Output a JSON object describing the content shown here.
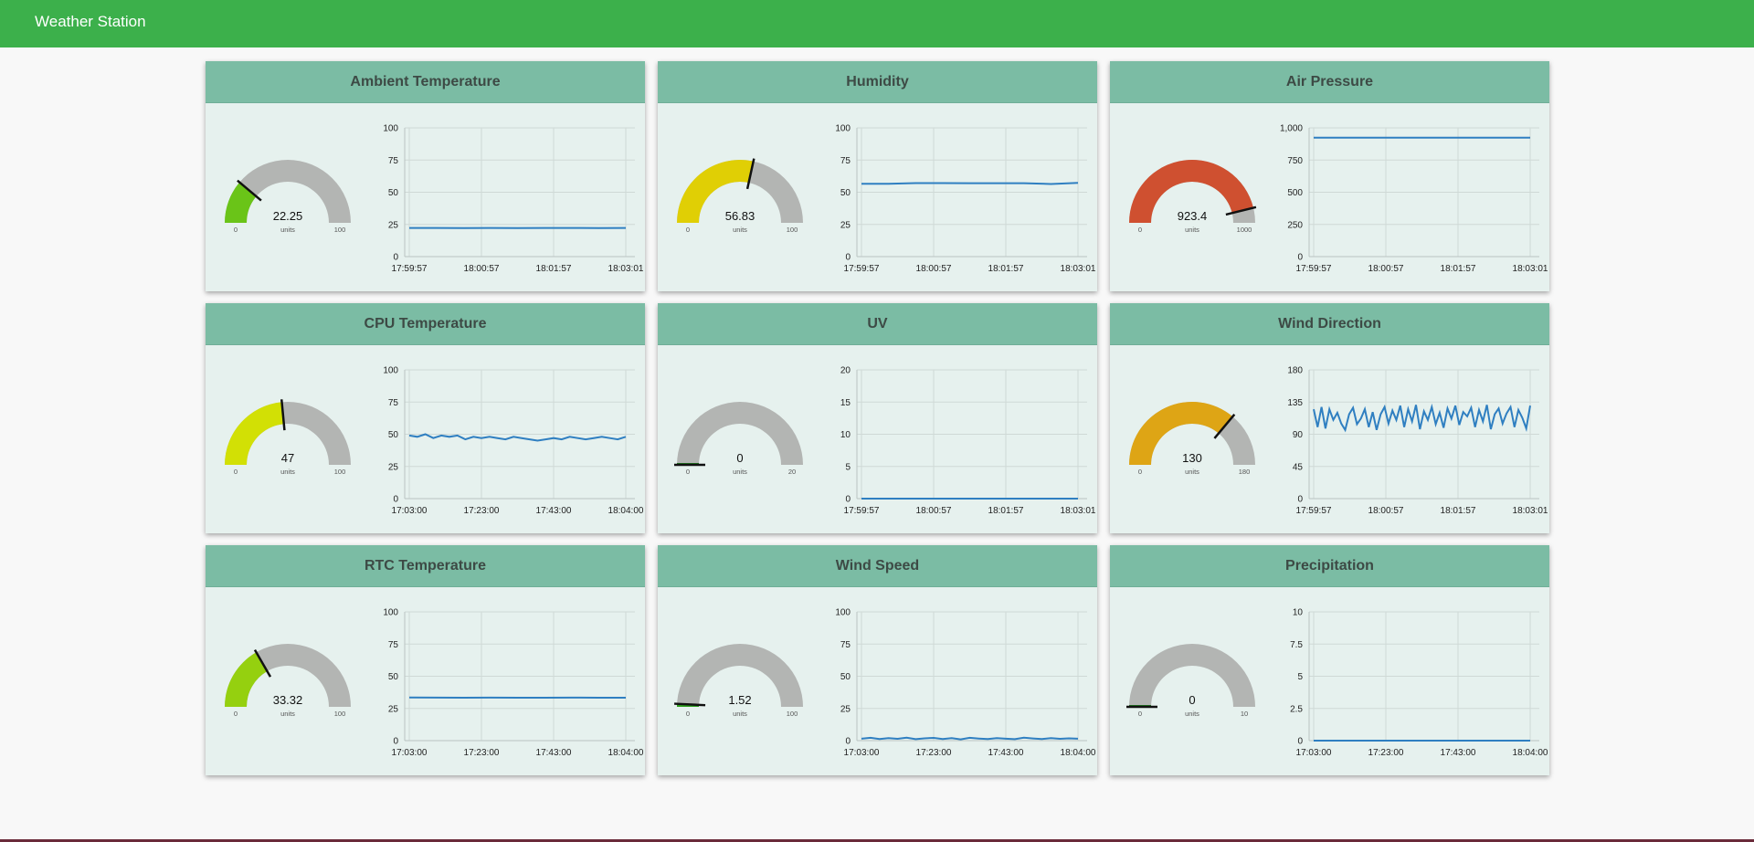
{
  "app": {
    "title": "Weather Station"
  },
  "colors": {
    "header_bar": "#3cb04b",
    "card_header": "#7bbca4",
    "card_bg": "#e6f1ee",
    "gauge_track": "#b3b5b3",
    "line": "#2f7fc1"
  },
  "cards": [
    {
      "title": "Ambient Temperature",
      "gauge": {
        "value": "22.25",
        "units": "units",
        "min": "0",
        "max": "100",
        "color": "#6ac418",
        "num": 22.25,
        "lo": 0,
        "hi": 100
      },
      "chart_data": {
        "type": "line",
        "y_ticks": [
          "100",
          "75",
          "50",
          "25",
          "0"
        ],
        "x_ticks": [
          "17:59:57",
          "18:00:57",
          "18:01:57",
          "18:03:01"
        ],
        "ylim": [
          0,
          100
        ],
        "series": [
          {
            "values": [
              22.3,
              22.3,
              22.2,
              22.3,
              22.2,
              22.3,
              22.3,
              22.2,
              22.25
            ]
          }
        ]
      }
    },
    {
      "title": "Humidity",
      "gauge": {
        "value": "56.83",
        "units": "units",
        "min": "0",
        "max": "100",
        "color": "#e0cf05",
        "num": 56.83,
        "lo": 0,
        "hi": 100
      },
      "chart_data": {
        "type": "line",
        "y_ticks": [
          "100",
          "75",
          "50",
          "25",
          "0"
        ],
        "x_ticks": [
          "17:59:57",
          "18:00:57",
          "18:01:57",
          "18:03:01"
        ],
        "ylim": [
          0,
          100
        ],
        "series": [
          {
            "values": [
              56.5,
              56.5,
              57.1,
              57.1,
              57.0,
              57.0,
              57.0,
              56.4,
              57.2
            ]
          }
        ]
      }
    },
    {
      "title": "Air Pressure",
      "gauge": {
        "value": "923.4",
        "units": "units",
        "min": "0",
        "max": "1000",
        "color": "#cf5030",
        "num": 923.4,
        "lo": 0,
        "hi": 1000
      },
      "chart_data": {
        "type": "line",
        "y_ticks": [
          "1,000",
          "750",
          "500",
          "250",
          "0"
        ],
        "x_ticks": [
          "17:59:57",
          "18:00:57",
          "18:01:57",
          "18:03:01"
        ],
        "ylim": [
          0,
          1000
        ],
        "series": [
          {
            "values": [
              923.5,
              923.4,
              923.4,
              923.5,
              923.4,
              923.4,
              923.3,
              923.4,
              923.4
            ]
          }
        ]
      }
    },
    {
      "title": "CPU Temperature",
      "gauge": {
        "value": "47",
        "units": "units",
        "min": "0",
        "max": "100",
        "color": "#d2e005",
        "num": 47,
        "lo": 0,
        "hi": 100
      },
      "chart_data": {
        "type": "line",
        "y_ticks": [
          "100",
          "75",
          "50",
          "25",
          "0"
        ],
        "x_ticks": [
          "17:03:00",
          "17:23:00",
          "17:43:00",
          "18:04:00"
        ],
        "ylim": [
          0,
          100
        ],
        "series": [
          {
            "values": [
              49,
              48,
              50,
              47,
              49,
              48,
              49,
              46,
              48,
              47,
              48,
              47,
              46,
              48,
              47,
              46,
              45,
              46,
              47,
              46,
              48,
              47,
              46,
              47,
              48,
              47,
              46,
              48
            ]
          }
        ]
      }
    },
    {
      "title": "UV",
      "gauge": {
        "value": "0",
        "units": "units",
        "min": "0",
        "max": "20",
        "color": "#b3b5b3",
        "num": 0,
        "lo": 0,
        "hi": 20
      },
      "chart_data": {
        "type": "line",
        "y_ticks": [
          "20",
          "15",
          "10",
          "5",
          "0"
        ],
        "x_ticks": [
          "17:59:57",
          "18:00:57",
          "18:01:57",
          "18:03:01"
        ],
        "ylim": [
          0,
          20
        ],
        "series": [
          {
            "values": [
              0,
              0,
              0,
              0,
              0,
              0,
              0,
              0,
              0
            ]
          }
        ]
      }
    },
    {
      "title": "Wind Direction",
      "gauge": {
        "value": "130",
        "units": "units",
        "min": "0",
        "max": "180",
        "color": "#dea515",
        "num": 130,
        "lo": 0,
        "hi": 180
      },
      "chart_data": {
        "type": "line",
        "y_ticks": [
          "180",
          "135",
          "90",
          "45",
          "0"
        ],
        "x_ticks": [
          "17:59:57",
          "18:00:57",
          "18:01:57",
          "18:03:01"
        ],
        "ylim": [
          0,
          180
        ],
        "series": [
          {
            "values": [
              125,
              100,
              128,
              98,
              125,
              110,
              120,
              105,
              96,
              118,
              127,
              104,
              112,
              125,
              100,
              121,
              96,
              118,
              128,
              105,
              123,
              110,
              130,
              100,
              125,
              108,
              131,
              97,
              122,
              110,
              128,
              104,
              120,
              99,
              126,
              112,
              130,
              103,
              121,
              115,
              127,
              100,
              124,
              108,
              131,
              97,
              118,
              126,
              105,
              119,
              128,
              100,
              124,
              113,
              98,
              130
            ]
          }
        ]
      }
    },
    {
      "title": "RTC Temperature",
      "gauge": {
        "value": "33.32",
        "units": "units",
        "min": "0",
        "max": "100",
        "color": "#95d00f",
        "num": 33.32,
        "lo": 0,
        "hi": 100
      },
      "chart_data": {
        "type": "line",
        "y_ticks": [
          "100",
          "75",
          "50",
          "25",
          "0"
        ],
        "x_ticks": [
          "17:03:00",
          "17:23:00",
          "17:43:00",
          "18:04:00"
        ],
        "ylim": [
          0,
          100
        ],
        "series": [
          {
            "values": [
              33.5,
              33.4,
              33.3,
              33.4,
              33.3,
              33.3,
              33.4,
              33.3,
              33.32
            ]
          }
        ]
      }
    },
    {
      "title": "Wind Speed",
      "gauge": {
        "value": "1.52",
        "units": "units",
        "min": "0",
        "max": "100",
        "color": "#2e9f1e",
        "num": 1.52,
        "lo": 0,
        "hi": 100
      },
      "chart_data": {
        "type": "line",
        "y_ticks": [
          "100",
          "75",
          "50",
          "25",
          "0"
        ],
        "x_ticks": [
          "17:03:00",
          "17:23:00",
          "17:43:00",
          "18:04:00"
        ],
        "ylim": [
          0,
          100
        ],
        "series": [
          {
            "values": [
              1.5,
              2.2,
              1.2,
              2.0,
              1.4,
              2.3,
              1.1,
              1.8,
              2.1,
              1.3,
              1.9,
              1.0,
              2.2,
              1.6,
              1.2,
              2.0,
              1.5,
              1.1,
              2.3,
              1.7,
              1.3,
              2.0,
              1.4,
              1.8,
              1.52
            ]
          }
        ]
      }
    },
    {
      "title": "Precipitation",
      "gauge": {
        "value": "0",
        "units": "units",
        "min": "0",
        "max": "10",
        "color": "#b3b5b3",
        "num": 0,
        "lo": 0,
        "hi": 10
      },
      "chart_data": {
        "type": "line",
        "y_ticks": [
          "10",
          "7.5",
          "5",
          "2.5",
          "0"
        ],
        "x_ticks": [
          "17:03:00",
          "17:23:00",
          "17:43:00",
          "18:04:00"
        ],
        "ylim": [
          0,
          10
        ],
        "series": [
          {
            "values": [
              0,
              0,
              0,
              0,
              0,
              0,
              0,
              0,
              0
            ]
          }
        ]
      }
    }
  ]
}
